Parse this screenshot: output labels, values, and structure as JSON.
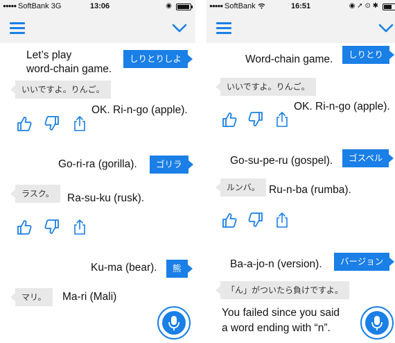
{
  "left": {
    "status": {
      "carrier": "SoftBank",
      "network": "3G",
      "time": "13:06",
      "indicators": "◉",
      "battery_level": 0.85
    },
    "user1": {
      "text_line1": "Let’s play",
      "text_line2": "word-chain game.",
      "bubble": "しりとりしよ"
    },
    "bot1": {
      "bubble": "いいですよ。りんご。",
      "text": "OK. Ri-n-go (apple)."
    },
    "user2": {
      "text": "Go-ri-ra (gorilla).",
      "bubble": "ゴリラ"
    },
    "bot2": {
      "bubble": "ラスク。",
      "text": "Ra-su-ku (rusk)."
    },
    "user3": {
      "text": "Ku-ma (bear).",
      "bubble": "熊"
    },
    "bot3": {
      "bubble": "マリ。",
      "text": "Ma-ri (Mali)"
    }
  },
  "right": {
    "status": {
      "carrier": "SoftBank",
      "network": "wifi",
      "time": "16:51",
      "indicators": "◉ ➚ ⊙ ✱",
      "battery_level": 0.55
    },
    "user1": {
      "text": "Word-chain game.",
      "bubble": "しりとり"
    },
    "bot1": {
      "bubble": "いいですよ。りんご。",
      "text": "OK. Ri-n-go (apple)."
    },
    "user2": {
      "text": "Go-su-pe-ru (gospel).",
      "bubble": "ゴスペル"
    },
    "bot2": {
      "bubble": "ルンバ。",
      "text": "Ru-n-ba (rumba)."
    },
    "user3": {
      "text": "Ba-a-jo-n (version).",
      "bubble": "バージョン"
    },
    "bot3": {
      "bubble": "「ん」がついたら負けですよ。",
      "text_line1": "You failed since you said",
      "text_line2": "a word ending with “n”."
    }
  },
  "colors": {
    "accent": "#1a7fe6",
    "bot_bubble": "#e8e8e8",
    "bar": "#f2f2f2"
  },
  "icons": [
    "menu-icon",
    "chevron-down-icon",
    "thumbs-up-icon",
    "thumbs-down-icon",
    "share-icon",
    "microphone-icon",
    "wifi-icon"
  ]
}
